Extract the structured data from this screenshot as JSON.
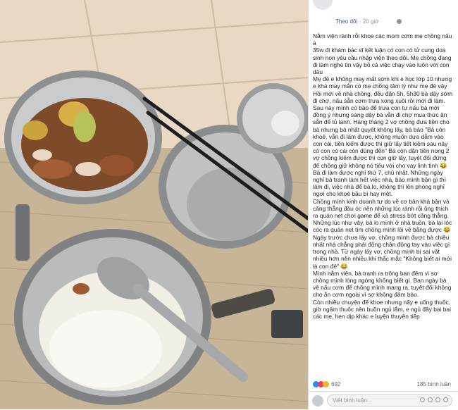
{
  "post": {
    "follow_label": "Theo dõi",
    "time": "· 20 giờ ·",
    "body": "Nằm viện rảnh rỗi khoe các mom cơm mẹ chồng nấu a\n35w đi khám bác sĩ kết luận có con có tử cung doạ sinh non yêu cầu nhập viện theo dõi. Mẹ chồng đang đi làm nghe tin vậy bỏ cả việc chạy vào luôn với con dâu\nMẹ đẻ e không may mất sớm khi e học lớp 10 nhưng e khá may mắn có mẹ chồng tâm lý như mẹ đẻ vậy\nHồi mới về nhà chồng, đều đặn 5h, 5h30 bà dậy sớm đi chợ, nấu sẵn cơm trưa xong xuôi rồi mới đi làm. Sau này mình có bảo để trưa con tự nấu bà mới đồng ý nhưng sáng dậy bà vẫn đi chợ mua thức ăn sẵn để tủ lạnh. Hàng tháng 2 vợ chồng đưa tiền cho bà nhưng bà nhất quyết không lấy, bà bảo \"Bà còn khoẻ, vẫn đi làm được, không muốn dựa dẫm vào con cái, tiền kiếm được thì giữ lấy tiết kiệm sau này có con có cái còn dùng đến\" Bà còn dặn tiền nong 2 vợ chồng kiếm được thì con giữ lấy, tuyệt đối đừng để chồng giữ không nó tiêu với cho vay linh tinh 😂\nBà đi làm được nghỉ thứ 7, chủ nhật. Những ngày nghỉ bà tranh làm hết việc nhà, bảo mình bận gì thì làm đi, việc nhà để bà lo, không thì lên phòng nghỉ ngơi cho khoẻ bầu bì hay mệt.\nChồng mình kinh doanh tự do về cơ bản khá bận và căng thẳng đầu óc nên những lúc rảnh rỗi ông thích ra quán net chơi game để xả stress bớt căng thẳng. Những lúc như vậy, bà lo mình ở nhà buồn, bà lại lóc cóc ra quán net tìm chồng mình lôi về bằng được 😂 Ngày trước chưa lấy vợ, chồng mình được bà chiều nhất nhà chẳng phải động chân động tay vào việc gì trong nhà. Từ ngày lấy vợ, chồng mình bị sai vặt nhiều hơn nên nhiều khi thắc mắc \"Không biết ai mới là con đẻ\" 😂\nMình nằm viện, bà tranh ra trông ban đêm vì sợ chồng mình lóng ngóng không biết gì. Ban ngày bà về nấu cơm để chồng mình mang ra, tuyệt đối không cho ăn cơm ngoài vì sợ không đảm bảo.\nCòn nhiều chuyện để khoe nhưng nãy e uống thuốc, giờ ngấm thuốc nên buồn ngủ lắm, e ngủ đây bai bai các mẹ, hẹn dịp khác e luyện thuyên tiếp",
    "reaction_count": "692",
    "comment_count": "185 bình luận",
    "comment_placeholder": "Viết bình luận..."
  },
  "colors": {
    "link": "#385898",
    "like": "#2d88ff",
    "love": "#f33e58",
    "haha": "#f7b125"
  }
}
